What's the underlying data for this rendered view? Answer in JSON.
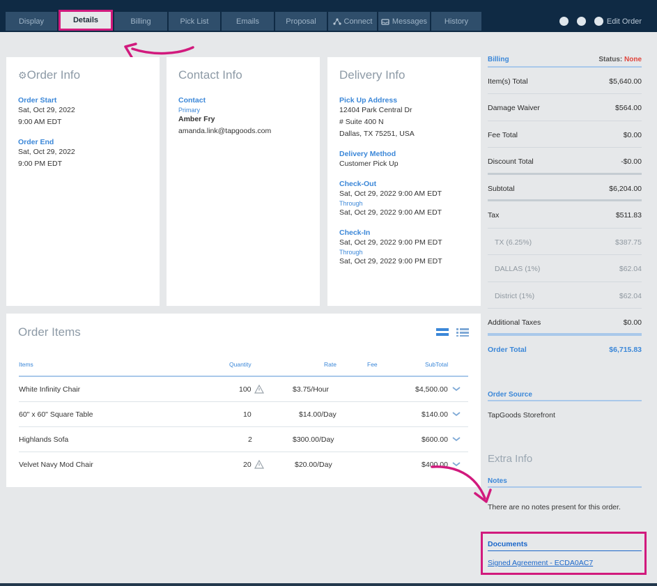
{
  "nav": {
    "tabs": [
      {
        "label": "Display"
      },
      {
        "label": "Details"
      },
      {
        "label": "Billing"
      },
      {
        "label": "Pick List"
      },
      {
        "label": "Emails"
      },
      {
        "label": "Proposal"
      },
      {
        "label": "Connect"
      },
      {
        "label": "Messages"
      },
      {
        "label": "History"
      }
    ],
    "edit_order_label": "Edit Order"
  },
  "order_info": {
    "title": "Order Info",
    "start_label": "Order Start",
    "start_date": "Sat, Oct 29, 2022",
    "start_time": "9:00 AM EDT",
    "end_label": "Order End",
    "end_date": "Sat, Oct 29, 2022",
    "end_time": "9:00 PM EDT"
  },
  "contact_info": {
    "title": "Contact Info",
    "contact_label": "Contact",
    "primary_label": "Primary",
    "name": "Amber Fry",
    "email": "amanda.link@tapgoods.com"
  },
  "delivery_info": {
    "title": "Delivery Info",
    "pickup_label": "Pick Up Address",
    "address_line1": "12404 Park Central Dr",
    "address_line2": "# Suite 400 N",
    "address_line3": "Dallas, TX 75251, USA",
    "method_label": "Delivery Method",
    "method": "Customer Pick Up",
    "checkout_label": "Check-Out",
    "checkout_from": "Sat, Oct 29, 2022 9:00 AM EDT",
    "checkout_through_label": "Through",
    "checkout_to": "Sat, Oct 29, 2022 9:00 AM EDT",
    "checkin_label": "Check-In",
    "checkin_from": "Sat, Oct 29, 2022 9:00 PM EDT",
    "checkin_through_label": "Through",
    "checkin_to": "Sat, Oct 29, 2022 9:00 PM EDT"
  },
  "order_items": {
    "title": "Order Items",
    "columns": {
      "item": "Items",
      "quantity": "Quantity",
      "rate": "Rate",
      "fee": "Fee",
      "subtotal": "SubTotal"
    },
    "rows": [
      {
        "name": "White Infinity Chair",
        "qty": "100",
        "rate": "$3.75/Hour",
        "subtotal": "$4,500.00",
        "warning": true
      },
      {
        "name": "60\" x 60\" Square Table",
        "qty": "10",
        "rate": "$14.00/Day",
        "subtotal": "$140.00",
        "warning": false
      },
      {
        "name": "Highlands Sofa",
        "qty": "2",
        "rate": "$300.00/Day",
        "subtotal": "$600.00",
        "warning": false
      },
      {
        "name": "Velvet Navy Mod Chair",
        "qty": "20",
        "rate": "$20.00/Day",
        "subtotal": "$400.00",
        "warning": true
      }
    ]
  },
  "billing": {
    "title": "Billing",
    "status_label": "Status:",
    "status_value": "None",
    "items_total_label": "Item(s) Total",
    "items_total": "$5,640.00",
    "damage_waiver_label": "Damage Waiver",
    "damage_waiver": "$564.00",
    "fee_total_label": "Fee Total",
    "fee_total": "$0.00",
    "discount_total_label": "Discount Total",
    "discount_total": "-$0.00",
    "subtotal_label": "Subtotal",
    "subtotal": "$6,204.00",
    "tax_label": "Tax",
    "tax": "$511.83",
    "tx_label": "TX (6.25%)",
    "tx": "$387.75",
    "dallas_label": "DALLAS (1%)",
    "dallas": "$62.04",
    "district_label": "District (1%)",
    "district": "$62.04",
    "additional_taxes_label": "Additional Taxes",
    "additional_taxes": "$0.00",
    "order_total_label": "Order Total",
    "order_total": "$6,715.83"
  },
  "order_source": {
    "title": "Order Source",
    "value": "TapGoods Storefront"
  },
  "extra_info": {
    "title": "Extra Info",
    "notes_label": "Notes",
    "notes_text": "There are no notes present for this order.",
    "documents_label": "Documents",
    "document_link": "Signed Agreement - ECDA0AC7"
  },
  "colors": {
    "accent": "#3b87d8",
    "highlight": "#d11a7d",
    "nav": "#0f2a44"
  }
}
